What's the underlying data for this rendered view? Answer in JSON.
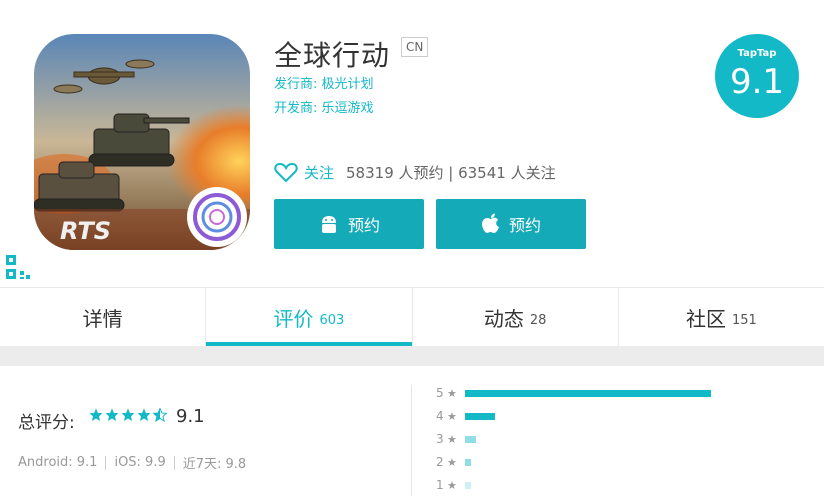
{
  "app": {
    "title": "全球行动",
    "region": "CN",
    "publisher": "发行商: 极光计划",
    "developer": "开发商: 乐逗游戏",
    "icon_text": "RTS"
  },
  "stats": {
    "follow_label": "关注",
    "reserve_count": "58319 人预约 | 63541 人关注"
  },
  "buttons": {
    "android_label": "预约",
    "ios_label": "预约"
  },
  "badge": {
    "brand": "TapTap",
    "score": "9.1"
  },
  "tabs": [
    {
      "label": "详情",
      "count": ""
    },
    {
      "label": "评价",
      "count": "603"
    },
    {
      "label": "动态",
      "count": "28"
    },
    {
      "label": "社区",
      "count": "151"
    }
  ],
  "rating": {
    "total_label": "总评分:",
    "total_value": "9.1",
    "android": "Android: 9.1",
    "ios": "iOS: 9.9",
    "recent": "近7天: 9.8",
    "distribution": [
      {
        "star": "5",
        "share": 0.82
      },
      {
        "star": "4",
        "share": 0.1
      },
      {
        "star": "3",
        "share": 0.035
      },
      {
        "star": "2",
        "share": 0.015
      },
      {
        "star": "1",
        "share": 0.015
      }
    ]
  },
  "colors": {
    "accent": "#14b9c8",
    "button": "#14aab8",
    "bar_light": "#8fdde6",
    "bar_lighter": "#cfeff2"
  },
  "icons": [
    "qr-code-icon",
    "heart-icon",
    "android-icon",
    "apple-icon",
    "star-icon"
  ]
}
